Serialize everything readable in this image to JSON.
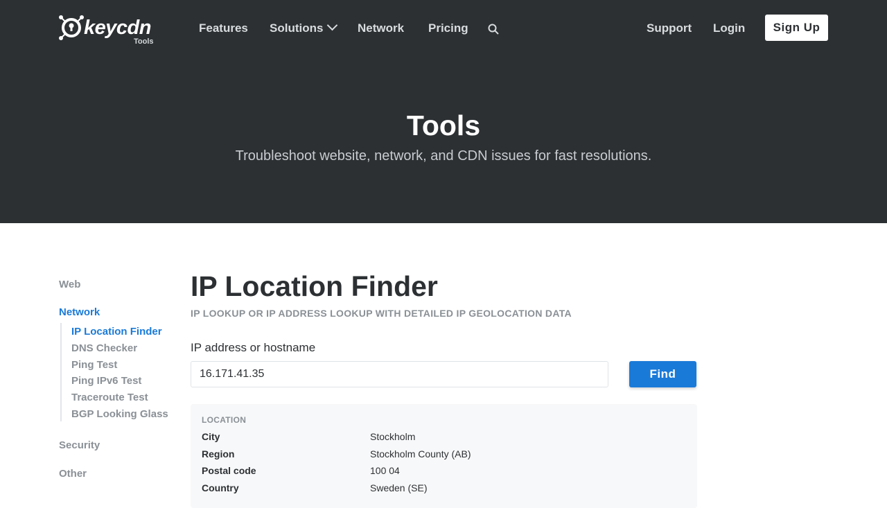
{
  "brand": {
    "name": "keycdn",
    "sub": "Tools"
  },
  "nav": {
    "features": "Features",
    "solutions": "Solutions",
    "network": "Network",
    "pricing": "Pricing",
    "support": "Support",
    "login": "Login",
    "signup": "Sign Up"
  },
  "hero": {
    "title": "Tools",
    "subtitle": "Troubleshoot website, network, and CDN issues for fast resolutions."
  },
  "sidebar": {
    "web": "Web",
    "network": "Network",
    "items": [
      "IP Location Finder",
      "DNS Checker",
      "Ping Test",
      "Ping IPv6 Test",
      "Traceroute Test",
      "BGP Looking Glass"
    ],
    "security": "Security",
    "other": "Other"
  },
  "main": {
    "title": "IP Location Finder",
    "subtitle": "IP LOOKUP OR IP ADDRESS LOOKUP WITH DETAILED IP GEOLOCATION DATA",
    "field_label": "IP address or hostname",
    "ip_value": "16.171.41.35",
    "find_label": "Find"
  },
  "results": {
    "heading": "LOCATION",
    "rows": [
      {
        "key": "City",
        "value": "Stockholm"
      },
      {
        "key": "Region",
        "value": "Stockholm County (AB)"
      },
      {
        "key": "Postal code",
        "value": "100 04"
      },
      {
        "key": "Country",
        "value": "Sweden (SE)"
      }
    ]
  },
  "colors": {
    "header_bg": "#2d3033",
    "accent": "#1a7ad8",
    "muted": "#8a9096"
  }
}
